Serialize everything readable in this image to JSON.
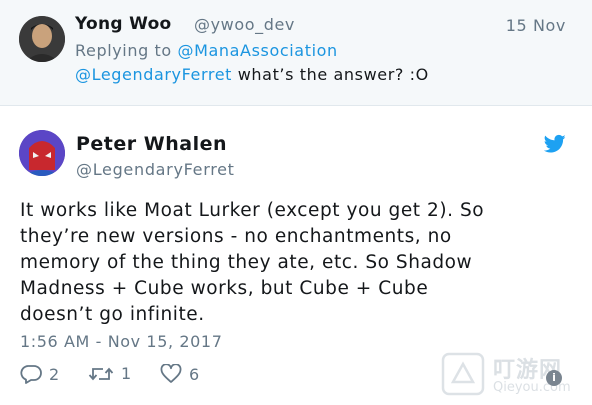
{
  "reply": {
    "name": "Yong Woo",
    "handle": "@ywoo_dev",
    "date": "15 Nov",
    "replying_prefix": "Replying to ",
    "replying_to": "@ManaAssociation",
    "mention": "@LegendaryFerret",
    "text": " what’s the answer? :O"
  },
  "tweet": {
    "name": "Peter Whalen",
    "handle": "@LegendaryFerret",
    "lines": [
      "It works like Moat Lurker (except you get 2). So",
      "they’re new versions - no enchantments, no",
      "memory of the thing they ate, etc. So Shadow",
      "Madness + Cube works, but Cube + Cube",
      "doesn’t go infinite."
    ],
    "timestamp": "1:56 AM - Nov 15, 2017",
    "replies": "2",
    "retweets": "1",
    "likes": "6"
  },
  "watermark": {
    "logo_text": "叮游网",
    "url": "Qieyou.com"
  },
  "colors": {
    "link": "#1b95e0",
    "muted": "#657786",
    "twitter_blue": "#1da1f2",
    "reply_bg": "#f5f8fa"
  },
  "icons": [
    "reply-icon",
    "retweet-icon",
    "heart-icon",
    "twitter-bird-icon",
    "info-icon"
  ]
}
